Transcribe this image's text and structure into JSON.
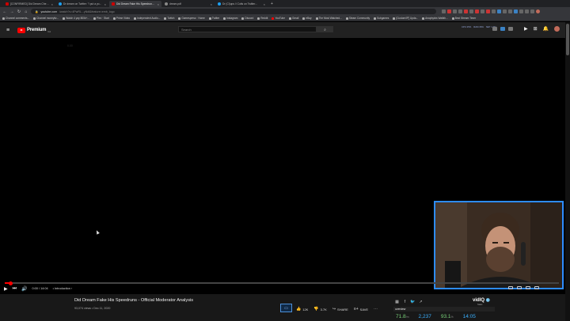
{
  "tabs": [
    {
      "label": "[CONFIRMED] Did Dream Chea...",
      "icon": "youtube-favicon",
      "active": false
    },
    {
      "label": "Dr dream on Twitter: \"I put a yo...",
      "icon": "twitter-favicon",
      "active": false
    },
    {
      "label": "Did Dream Fake His Speedrun...",
      "icon": "youtube-favicon",
      "active": true
    },
    {
      "label": "dream.pdf",
      "icon": "pdf-favicon",
      "active": false
    },
    {
      "label": "Dr (Cl)ups // Colts on Twitter...",
      "icon": "twitter-favicon",
      "active": false
    }
  ],
  "address": {
    "domain": "youtube.com",
    "path": "/watch?v=4PwRL...yNdl&feature=emb_logo"
  },
  "bookmarks": [
    "Channel comments...",
    "Channel moneytiz...",
    "Watch 4 yay 800k+...",
    "Plex · Start",
    "Prime Video",
    "Independent Audio...",
    "Twitch",
    "Gamespress · Home",
    "Twitter",
    "Instagram",
    "Discord",
    "Reddit",
    "YouTube",
    "Gmail",
    "eBay",
    "The Most Watched...",
    "Steam Community",
    "Subgames",
    "[Custom/IP] Upda...",
    "Anaphylxis Walkth...",
    "Best Stream Timer"
  ],
  "header": {
    "logo_word": "Premium",
    "logo_badge": "CA",
    "search_placeholder": "Search",
    "sys_stats": [
      "CPU 25%",
      "RAM 36%",
      "NET 1.7M"
    ]
  },
  "player": {
    "ghost_text": "0.00",
    "time_current": "0:00",
    "time_total": "14:04",
    "chapter": "Introduction",
    "progress": 0.01
  },
  "video": {
    "title": "Did Dream Fake His Speedruns - Official Moderator Analysis",
    "views": "93,074 views",
    "date": "Dec 11, 2020",
    "likes": "12K",
    "dislikes": "3.7K",
    "share_label": "SHARE",
    "save_label": "SAVE"
  },
  "vidiq": {
    "logo_text": "vidIQ",
    "sub": "Stats",
    "tab": "overview",
    "stats": [
      "71.8",
      "2,237",
      "93.1",
      "14:05"
    ],
    "stat_suffixes": [
      "/m",
      "",
      "%",
      ""
    ]
  },
  "colors": {
    "accent": "#ff0000",
    "webcam_border": "#2d8cff",
    "vidiq_blue": "#3ab0ff"
  }
}
